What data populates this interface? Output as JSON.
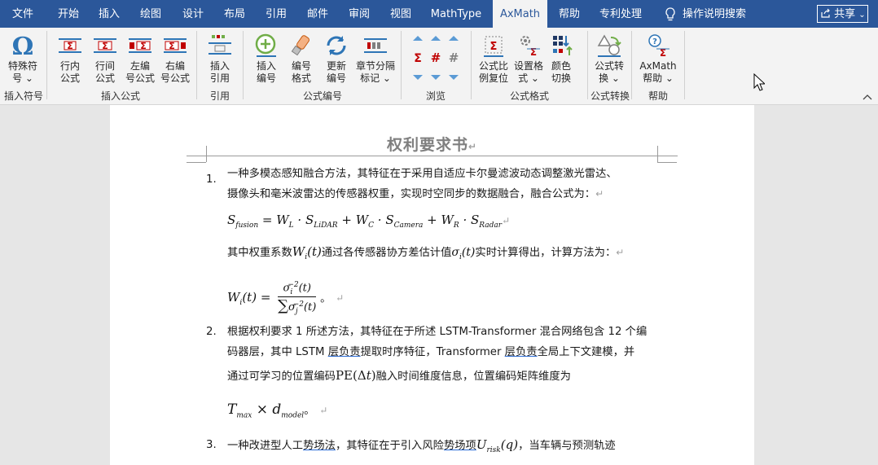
{
  "tabs": [
    "文件",
    "开始",
    "插入",
    "绘图",
    "设计",
    "布局",
    "引用",
    "邮件",
    "审阅",
    "视图",
    "MathType",
    "AxMath",
    "帮助",
    "专利处理"
  ],
  "active_tab": "AxMath",
  "search_label": "操作说明搜索",
  "share_label": "共享",
  "ribbon": {
    "special_symbol": [
      "特殊符",
      "号 ⌄"
    ],
    "inline_formula": [
      "行内",
      "公式"
    ],
    "display_formula": [
      "行间",
      "公式"
    ],
    "left_num_formula": [
      "左编",
      "号公式"
    ],
    "right_num_formula": [
      "右编",
      "号公式"
    ],
    "insert_ref": [
      "插入",
      "引用"
    ],
    "insert_num": [
      "插入",
      "编号"
    ],
    "num_format": [
      "编号",
      "格式"
    ],
    "update_num": [
      "更新",
      "编号"
    ],
    "chapter_mark": [
      "章节分隔",
      "标记 ⌄"
    ],
    "ratio_reset": [
      "公式比",
      "例复位"
    ],
    "set_format": [
      "设置格",
      "式 ⌄"
    ],
    "color_switch": [
      "颜色",
      "切换"
    ],
    "convert": [
      "公式转",
      "换 ⌄"
    ],
    "axmath_help": [
      "AxMath",
      "帮助 ⌄"
    ],
    "groups": [
      "插入符号",
      "插入公式",
      "引用",
      "公式编号",
      "浏览",
      "公式格式",
      "公式转换",
      "帮助"
    ]
  },
  "document": {
    "title": "权利要求书",
    "claim1_num": "1.",
    "claim1_line1": "一种多模态感知融合方法，其特征在于采用自适应卡尔曼滤波动态调整激光雷达、",
    "claim1_line2": "摄像头和毫米波雷达的传感器权重，实现时空同步的数据融合，融合公式为：",
    "claim1_weight_pre": "其中权重系数",
    "claim1_weight_mid": "通过各传感器协方差估计值",
    "claim1_weight_post": "实时计算得出，计算方法为：",
    "claim2_num": "2.",
    "claim2_line1": "根据权利要求 1 所述方法，其特征在于所述 LSTM-Transformer 混合网络包含 12 个编",
    "claim2_line2a": "码器层，其中 LSTM ",
    "claim2_line2b": "层负责",
    "claim2_line2c": "提取时序特征，Transformer ",
    "claim2_line2d": "层负责",
    "claim2_line2e": "全局上下文建模，并",
    "claim2_line3a": "通过可学习的位置编码",
    "claim2_line3b": "融入时间维度信息，位置编码矩阵维度为",
    "claim2_end": "。",
    "claim3_num": "3.",
    "claim3_line1a": "一种改进型人工",
    "claim3_line1b": "势场法",
    "claim3_line1c": "，其特征在于引入风险",
    "claim3_line1d": "势场项",
    "claim3_line1e": "，当车辆与预测轨迹"
  }
}
